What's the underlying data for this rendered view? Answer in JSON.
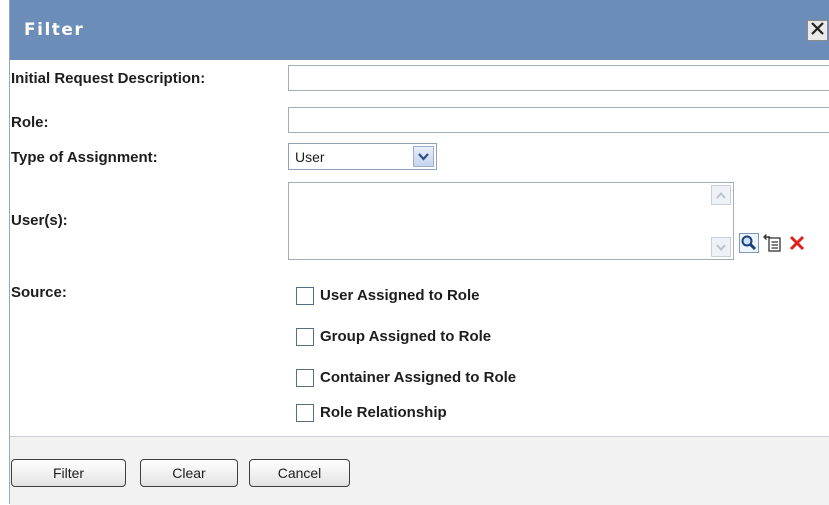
{
  "dialog": {
    "title": "Filter",
    "close_icon": "close-icon"
  },
  "fields": {
    "initial_request_description": {
      "label": "Initial Request Description:",
      "value": ""
    },
    "role": {
      "label": "Role:",
      "value": ""
    },
    "type_of_assignment": {
      "label": "Type of Assignment:",
      "selected": "User"
    },
    "users": {
      "label": "User(s):",
      "value": ""
    },
    "source": {
      "label": "Source:"
    }
  },
  "user_tools": {
    "search_icon": "magnifier-icon",
    "history_icon": "selection-history-icon",
    "clear_icon": "red-x-delete-icon"
  },
  "source_options": [
    {
      "label": "User Assigned to Role",
      "checked": false
    },
    {
      "label": "Group Assigned to Role",
      "checked": false
    },
    {
      "label": "Container Assigned to Role",
      "checked": false
    },
    {
      "label": "Role Relationship",
      "checked": false
    }
  ],
  "buttons": {
    "filter": "Filter",
    "clear": "Clear",
    "cancel": "Cancel"
  },
  "colors": {
    "titlebar": "#6b8db7",
    "footer": "#f2f2f2"
  }
}
